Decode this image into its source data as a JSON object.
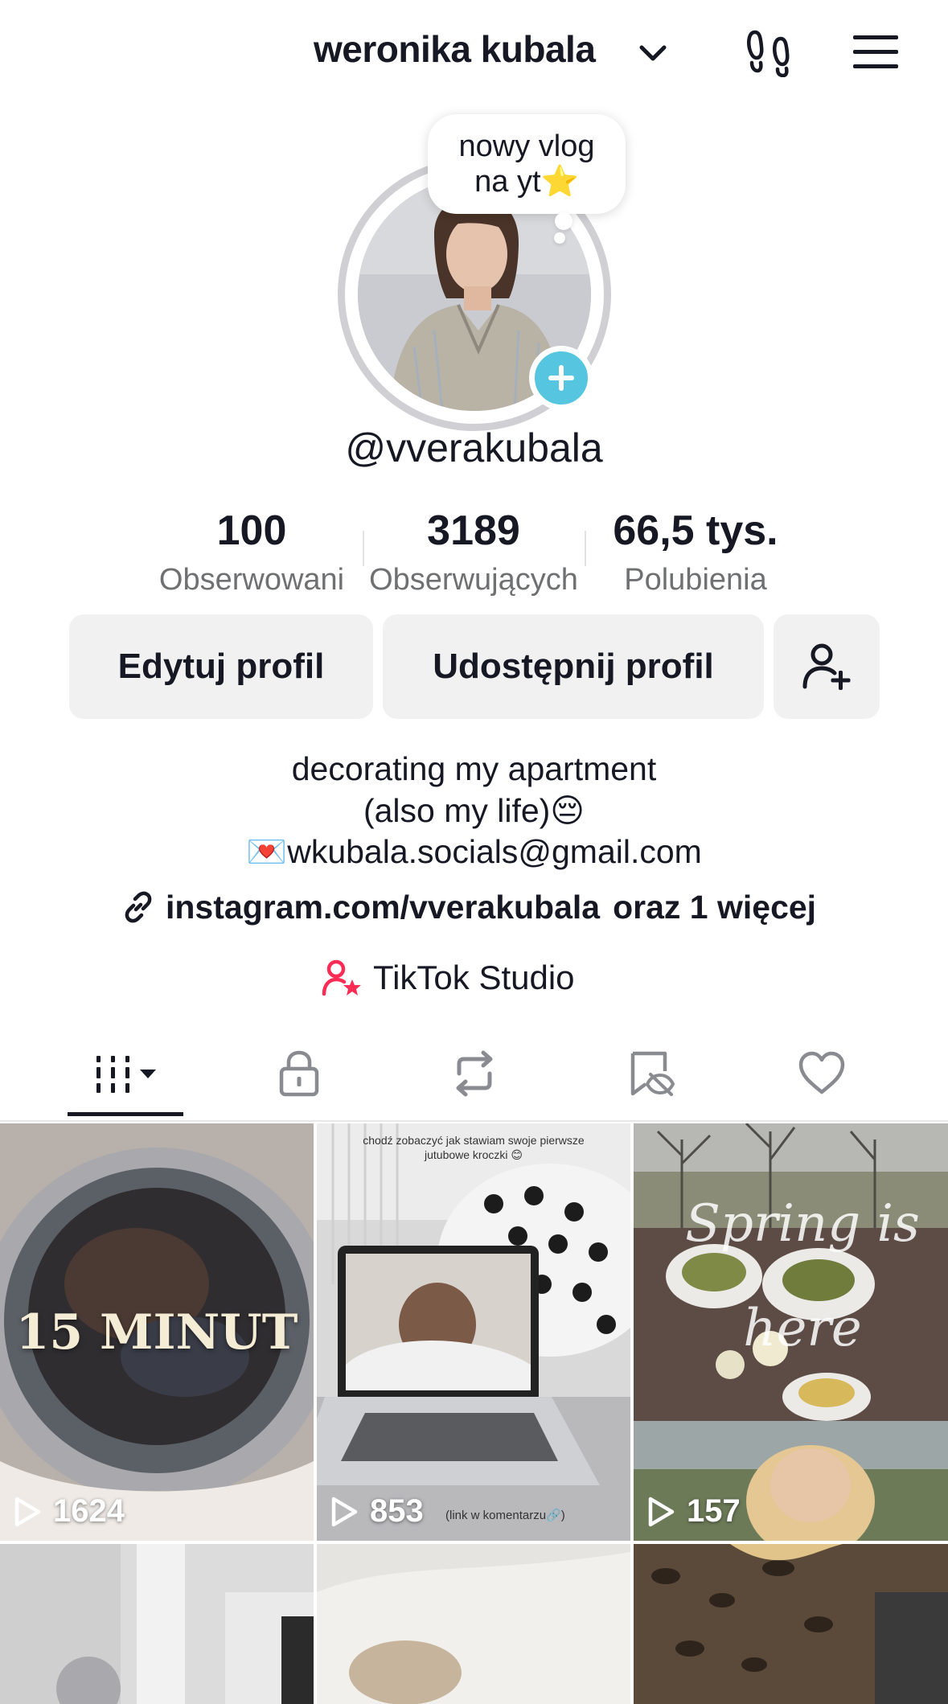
{
  "header": {
    "username": "weronika kubala"
  },
  "avatar": {
    "bubble_line1": "nowy vlog",
    "bubble_line2": "na yt⭐"
  },
  "handle": "@vverakubala",
  "stats": [
    {
      "value": "100",
      "label": "Obserwowani"
    },
    {
      "value": "3189",
      "label": "Obserwujących"
    },
    {
      "value": "66,5 tys.",
      "label": "Polubienia"
    }
  ],
  "buttons": {
    "edit": "Edytuj profil",
    "share": "Udostępnij profil"
  },
  "bio": {
    "line1": "decorating my apartment",
    "line2": "(also my life)😔",
    "line3": "💌wkubala.socials@gmail.com"
  },
  "link": {
    "url": "instagram.com/vverakubala",
    "more": "oraz 1 więcej"
  },
  "studio": {
    "label": "TikTok Studio"
  },
  "videos": [
    {
      "views": "1624",
      "overlay": "15 MINUT"
    },
    {
      "views": "853",
      "caption_top": "chodź zobaczyć jak stawiam swoje pierwsze jutubowe kroczki 😊",
      "caption_bottom": "(link w komentarzu🔗)"
    },
    {
      "views": "157",
      "overlay": "Spring is here"
    },
    {
      "views": ""
    },
    {
      "views": ""
    },
    {
      "views": ""
    }
  ],
  "colors": {
    "accent_blue": "#56c6e0",
    "studio_pink": "#fe2c55",
    "button_bg": "#f1f1f2",
    "text_primary": "#161823",
    "text_secondary": "#6f7072"
  }
}
